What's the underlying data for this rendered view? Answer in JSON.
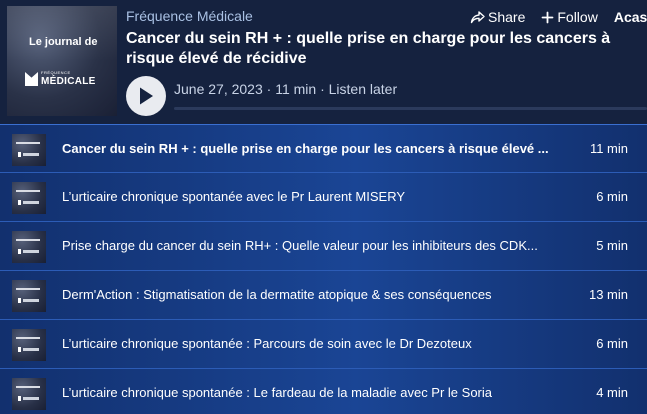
{
  "player": {
    "show_name": "Fréquence Médicale",
    "episode_title": "Cancer du sein RH + : quelle prise en charge pour les cancers à risque élevé de récidive",
    "date": "June 27, 2023",
    "duration": "11 min",
    "listen_later": "Listen later",
    "separator": "·",
    "progress": 0,
    "cover": {
      "title": "Le journal de",
      "logo_small": "FRÉQUENCE",
      "logo_big": "MÉDICALE"
    },
    "actions": {
      "share": "Share",
      "follow": "Follow",
      "brand": "Acast"
    }
  },
  "episodes": [
    {
      "title": "Cancer du sein RH + : quelle prise en charge pour les cancers à risque élevé ...",
      "duration": "11 min",
      "active": true
    },
    {
      "title": "L’urticaire chronique spontanée avec le Pr Laurent MISERY",
      "duration": "6 min",
      "active": false
    },
    {
      "title": "Prise charge du cancer du sein RH+ : Quelle valeur pour les inhibiteurs des CDK...",
      "duration": "5 min",
      "active": false
    },
    {
      "title": "Derm'Action : Stigmatisation de la dermatite atopique & ses conséquences",
      "duration": "13 min",
      "active": false
    },
    {
      "title": "L’urticaire chronique spontanée : Parcours de soin avec le Dr Dezoteux",
      "duration": "6 min",
      "active": false
    },
    {
      "title": "L’urticaire chronique spontanée : Le fardeau de la maladie avec Pr le Soria",
      "duration": "4 min",
      "active": false
    }
  ],
  "colors": {
    "background": "#15223f",
    "list_background": "#1a4595",
    "accent_text": "#a9c0e3"
  },
  "icons": {
    "share": "share-icon",
    "follow": "plus-icon",
    "play": "play-icon"
  }
}
